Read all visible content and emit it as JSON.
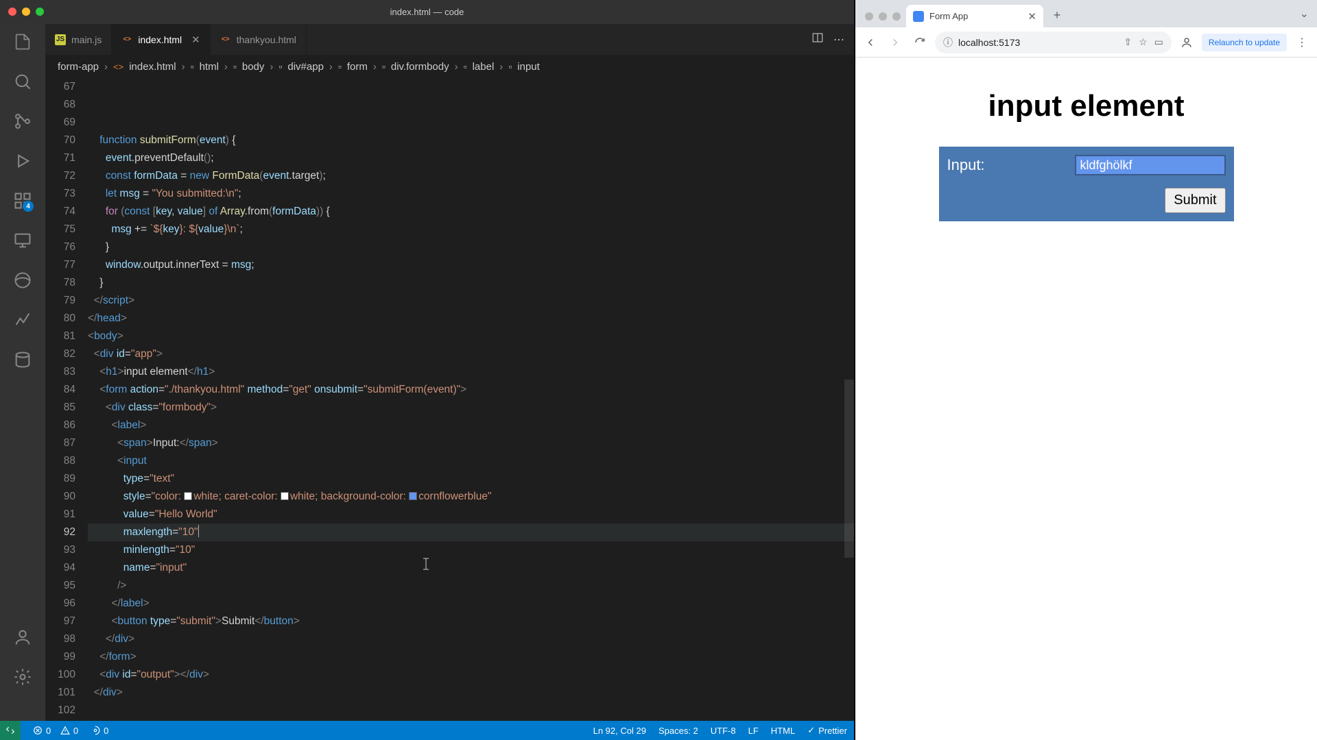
{
  "vscode": {
    "window_title": "index.html — code",
    "tabs": [
      {
        "name": "main.js",
        "active": false,
        "lang": "js"
      },
      {
        "name": "index.html",
        "active": true,
        "lang": "html"
      },
      {
        "name": "thankyou.html",
        "active": false,
        "lang": "html"
      }
    ],
    "activity_badge": "4",
    "breadcrumbs": [
      "form-app",
      "index.html",
      "html",
      "body",
      "div#app",
      "form",
      "div.formbody",
      "label",
      "input"
    ],
    "cursor": "Ln 92, Col 29",
    "spaces": "Spaces: 2",
    "encoding": "UTF-8",
    "eol": "LF",
    "lang_mode": "HTML",
    "formatter": "Prettier",
    "errors": "0",
    "warnings": "0",
    "ports": "0",
    "lines": {
      "67": {
        "indent": 4,
        "segs": [
          [
            "kw",
            "function "
          ],
          [
            "fn",
            "submitForm"
          ],
          [
            "punc",
            "("
          ],
          [
            "var",
            "event"
          ],
          [
            "punc",
            ")"
          ],
          [
            "",
            " {"
          ]
        ]
      },
      "68": {
        "indent": 6,
        "segs": [
          [
            "var",
            "event"
          ],
          [
            "",
            ".preventDefault"
          ],
          [
            "punc",
            "("
          ],
          [
            "punc",
            ")"
          ],
          [
            "",
            ";"
          ]
        ]
      },
      "69": {
        "indent": 0,
        "segs": [
          [
            "",
            ""
          ]
        ]
      },
      "70": {
        "indent": 6,
        "segs": [
          [
            "kw",
            "const "
          ],
          [
            "var",
            "formData"
          ],
          [
            "",
            " = "
          ],
          [
            "kw",
            "new "
          ],
          [
            "fn",
            "FormData"
          ],
          [
            "punc",
            "("
          ],
          [
            "var",
            "event"
          ],
          [
            "",
            ".target"
          ],
          [
            "punc",
            ")"
          ],
          [
            "",
            ";"
          ]
        ]
      },
      "71": {
        "indent": 6,
        "segs": [
          [
            "kw",
            "let "
          ],
          [
            "var",
            "msg"
          ],
          [
            "",
            " = "
          ],
          [
            "str",
            "\"You submitted:\\n\""
          ],
          [
            "",
            ";"
          ]
        ]
      },
      "72": {
        "indent": 0,
        "segs": [
          [
            "",
            ""
          ]
        ]
      },
      "73": {
        "indent": 6,
        "segs": [
          [
            "kw2",
            "for "
          ],
          [
            "punc",
            "("
          ],
          [
            "kw",
            "const "
          ],
          [
            "punc",
            "["
          ],
          [
            "var",
            "key"
          ],
          [
            "",
            ", "
          ],
          [
            "var",
            "value"
          ],
          [
            "punc",
            "]"
          ],
          [
            "",
            " "
          ],
          [
            "kw",
            "of "
          ],
          [
            "fn",
            "Array"
          ],
          [
            "",
            ".from"
          ],
          [
            "punc",
            "("
          ],
          [
            "var",
            "formData"
          ],
          [
            "punc",
            ")"
          ],
          [
            "punc",
            ")"
          ],
          [
            "",
            " {"
          ]
        ]
      },
      "74": {
        "indent": 8,
        "segs": [
          [
            "var",
            "msg"
          ],
          [
            "",
            " += "
          ],
          [
            "str",
            "`${"
          ],
          [
            "var",
            "key"
          ],
          [
            "str",
            "}: ${"
          ],
          [
            "var",
            "value"
          ],
          [
            "str",
            "}\\n`"
          ],
          [
            "",
            ";"
          ]
        ]
      },
      "75": {
        "indent": 6,
        "segs": [
          [
            "",
            "}"
          ]
        ]
      },
      "76": {
        "indent": 0,
        "segs": [
          [
            "",
            ""
          ]
        ]
      },
      "77": {
        "indent": 6,
        "segs": [
          [
            "var",
            "window"
          ],
          [
            "",
            ".output.innerText = "
          ],
          [
            "var",
            "msg"
          ],
          [
            "",
            ";"
          ]
        ]
      },
      "78": {
        "indent": 4,
        "segs": [
          [
            "",
            "}"
          ]
        ]
      },
      "79": {
        "indent": 2,
        "segs": [
          [
            "punc",
            "</"
          ],
          [
            "tag",
            "script"
          ],
          [
            "punc",
            ">"
          ]
        ]
      },
      "80": {
        "indent": 0,
        "segs": [
          [
            "punc",
            "</"
          ],
          [
            "tag",
            "head"
          ],
          [
            "punc",
            ">"
          ]
        ]
      },
      "81": {
        "indent": 0,
        "segs": [
          [
            "punc",
            "<"
          ],
          [
            "tag",
            "body"
          ],
          [
            "punc",
            ">"
          ]
        ]
      },
      "82": {
        "indent": 2,
        "segs": [
          [
            "punc",
            "<"
          ],
          [
            "tag",
            "div "
          ],
          [
            "attr",
            "id"
          ],
          [
            "",
            "="
          ],
          [
            "str",
            "\"app\""
          ],
          [
            "punc",
            ">"
          ]
        ]
      },
      "83": {
        "indent": 4,
        "segs": [
          [
            "punc",
            "<"
          ],
          [
            "tag",
            "h1"
          ],
          [
            "punc",
            ">"
          ],
          [
            "",
            "input element"
          ],
          [
            "punc",
            "</"
          ],
          [
            "tag",
            "h1"
          ],
          [
            "punc",
            ">"
          ]
        ]
      },
      "84": {
        "indent": 4,
        "segs": [
          [
            "punc",
            "<"
          ],
          [
            "tag",
            "form "
          ],
          [
            "attr",
            "action"
          ],
          [
            "",
            "="
          ],
          [
            "str",
            "\"./thankyou.html\""
          ],
          [
            "",
            " "
          ],
          [
            "attr",
            "method"
          ],
          [
            "",
            "="
          ],
          [
            "str",
            "\"get\""
          ],
          [
            "",
            " "
          ],
          [
            "attr",
            "onsubmit"
          ],
          [
            "",
            "="
          ],
          [
            "str",
            "\"submitForm(event)\""
          ],
          [
            "punc",
            ">"
          ]
        ]
      },
      "85": {
        "indent": 6,
        "segs": [
          [
            "punc",
            "<"
          ],
          [
            "tag",
            "div "
          ],
          [
            "attr",
            "class"
          ],
          [
            "",
            "="
          ],
          [
            "str",
            "\"formbody\""
          ],
          [
            "punc",
            ">"
          ]
        ]
      },
      "86": {
        "indent": 8,
        "segs": [
          [
            "punc",
            "<"
          ],
          [
            "tag",
            "label"
          ],
          [
            "punc",
            ">"
          ]
        ]
      },
      "87": {
        "indent": 10,
        "segs": [
          [
            "punc",
            "<"
          ],
          [
            "tag",
            "span"
          ],
          [
            "punc",
            ">"
          ],
          [
            "",
            "Input:"
          ],
          [
            "punc",
            "</"
          ],
          [
            "tag",
            "span"
          ],
          [
            "punc",
            ">"
          ]
        ]
      },
      "88": {
        "indent": 10,
        "segs": [
          [
            "punc",
            "<"
          ],
          [
            "tag",
            "input"
          ]
        ]
      },
      "89": {
        "indent": 12,
        "segs": [
          [
            "attr",
            "type"
          ],
          [
            "",
            "="
          ],
          [
            "str",
            "\"text\""
          ]
        ]
      },
      "90": {
        "indent": 12,
        "segs": [
          [
            "attr",
            "style"
          ],
          [
            "",
            "="
          ],
          [
            "str",
            "\"color: "
          ],
          [
            "cbox",
            "white"
          ],
          [
            "str",
            "white; caret-color: "
          ],
          [
            "cbox",
            "white"
          ],
          [
            "str",
            "white; background-color: "
          ],
          [
            "cbox",
            "cfb"
          ],
          [
            "str",
            "cornflowerblue\""
          ]
        ]
      },
      "91": {
        "indent": 12,
        "segs": [
          [
            "attr",
            "value"
          ],
          [
            "",
            "="
          ],
          [
            "str",
            "\"Hello World\""
          ]
        ]
      },
      "92": {
        "indent": 12,
        "active": true,
        "segs": [
          [
            "attr",
            "maxlength"
          ],
          [
            "",
            "="
          ],
          [
            "str",
            "\"10\""
          ],
          [
            "cursor",
            ""
          ]
        ]
      },
      "93": {
        "indent": 12,
        "segs": [
          [
            "attr",
            "minlength"
          ],
          [
            "",
            "="
          ],
          [
            "str",
            "\"10\""
          ]
        ]
      },
      "94": {
        "indent": 12,
        "segs": [
          [
            "attr",
            "name"
          ],
          [
            "",
            "="
          ],
          [
            "str",
            "\"input\""
          ]
        ]
      },
      "95": {
        "indent": 10,
        "segs": [
          [
            "punc",
            "/>"
          ]
        ]
      },
      "96": {
        "indent": 8,
        "segs": [
          [
            "punc",
            "</"
          ],
          [
            "tag",
            "label"
          ],
          [
            "punc",
            ">"
          ]
        ]
      },
      "97": {
        "indent": 0,
        "segs": [
          [
            "",
            ""
          ]
        ]
      },
      "98": {
        "indent": 8,
        "segs": [
          [
            "punc",
            "<"
          ],
          [
            "tag",
            "button "
          ],
          [
            "attr",
            "type"
          ],
          [
            "",
            "="
          ],
          [
            "str",
            "\"submit\""
          ],
          [
            "punc",
            ">"
          ],
          [
            "",
            "Submit"
          ],
          [
            "punc",
            "</"
          ],
          [
            "tag",
            "button"
          ],
          [
            "punc",
            ">"
          ]
        ]
      },
      "99": {
        "indent": 6,
        "segs": [
          [
            "punc",
            "</"
          ],
          [
            "tag",
            "div"
          ],
          [
            "punc",
            ">"
          ]
        ]
      },
      "100": {
        "indent": 4,
        "segs": [
          [
            "punc",
            "</"
          ],
          [
            "tag",
            "form"
          ],
          [
            "punc",
            ">"
          ]
        ]
      },
      "101": {
        "indent": 4,
        "segs": [
          [
            "punc",
            "<"
          ],
          [
            "tag",
            "div "
          ],
          [
            "attr",
            "id"
          ],
          [
            "",
            "="
          ],
          [
            "str",
            "\"output\""
          ],
          [
            "punc",
            "></"
          ],
          [
            "tag",
            "div"
          ],
          [
            "punc",
            ">"
          ]
        ]
      },
      "102": {
        "indent": 2,
        "segs": [
          [
            "punc",
            "</"
          ],
          [
            "tag",
            "div"
          ],
          [
            "punc",
            ">"
          ]
        ]
      }
    }
  },
  "browser": {
    "tab_title": "Form App",
    "url": "localhost:5173",
    "relaunch": "Relaunch to update",
    "page_heading": "input element",
    "input_label": "Input:",
    "input_value": "kldfghölkf",
    "submit_label": "Submit"
  }
}
